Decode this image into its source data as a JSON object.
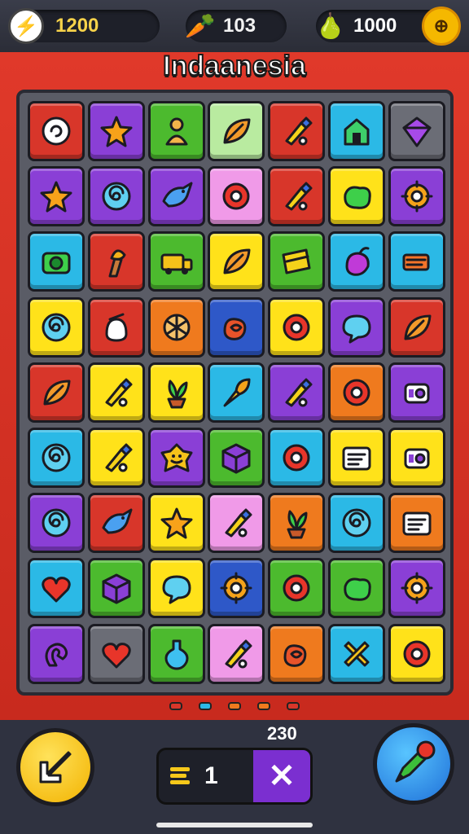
{
  "topbar": {
    "coins": "1200",
    "carrots": "103",
    "gems": "1000"
  },
  "title": "Indaanesia",
  "colors": {
    "red": "#d8362a",
    "purple": "#8a3fd6",
    "green": "#4cba2e",
    "lightgreen": "#b9eba0",
    "cyan": "#2bb9e6",
    "gray": "#6b6d76",
    "yellow": "#ffe21a",
    "pink": "#f09ae8",
    "orange": "#ef7a1e",
    "blue": "#2e58c8",
    "darkpurple": "#6a2fc0"
  },
  "board": {
    "rows": [
      [
        [
          "red",
          "swirl"
        ],
        [
          "purple",
          "star"
        ],
        [
          "green",
          "idol"
        ],
        [
          "lightgreen",
          "leaf"
        ],
        [
          "red",
          "crayon"
        ],
        [
          "cyan",
          "house"
        ],
        [
          "gray",
          "gem"
        ]
      ],
      [
        [
          "purple",
          "star"
        ],
        [
          "purple",
          "spiral"
        ],
        [
          "purple",
          "bird"
        ],
        [
          "pink",
          "ring"
        ],
        [
          "red",
          "crayon"
        ],
        [
          "yellow",
          "blob"
        ],
        [
          "purple",
          "gear"
        ]
      ],
      [
        [
          "cyan",
          "camera"
        ],
        [
          "red",
          "torch"
        ],
        [
          "green",
          "truck"
        ],
        [
          "yellow",
          "leaf"
        ],
        [
          "green",
          "book"
        ],
        [
          "cyan",
          "fruit"
        ],
        [
          "cyan",
          "cart"
        ]
      ],
      [
        [
          "yellow",
          "spiral"
        ],
        [
          "red",
          "sack"
        ],
        [
          "orange",
          "ball"
        ],
        [
          "blue",
          "knot"
        ],
        [
          "yellow",
          "ring"
        ],
        [
          "purple",
          "bubble"
        ],
        [
          "red",
          "leaf"
        ]
      ],
      [
        [
          "red",
          "leaf"
        ],
        [
          "yellow",
          "crayon"
        ],
        [
          "yellow",
          "plant"
        ],
        [
          "cyan",
          "brush"
        ],
        [
          "purple",
          "crayon"
        ],
        [
          "orange",
          "ring"
        ],
        [
          "purple",
          "tag"
        ]
      ],
      [
        [
          "cyan",
          "spiral"
        ],
        [
          "yellow",
          "crayon"
        ],
        [
          "purple",
          "smile"
        ],
        [
          "green",
          "box"
        ],
        [
          "cyan",
          "ring"
        ],
        [
          "yellow",
          "screen"
        ],
        [
          "yellow",
          "tag"
        ]
      ],
      [
        [
          "purple",
          "spiral"
        ],
        [
          "red",
          "bird"
        ],
        [
          "yellow",
          "star"
        ],
        [
          "pink",
          "crayon"
        ],
        [
          "orange",
          "plant"
        ],
        [
          "cyan",
          "spiral"
        ],
        [
          "orange",
          "screen"
        ]
      ],
      [
        [
          "cyan",
          "heart"
        ],
        [
          "green",
          "box"
        ],
        [
          "yellow",
          "bubble"
        ],
        [
          "blue",
          "gear"
        ],
        [
          "green",
          "ring"
        ],
        [
          "green",
          "blob"
        ],
        [
          "purple",
          "gear"
        ]
      ],
      [
        [
          "purple",
          "hook"
        ],
        [
          "gray",
          "heart"
        ],
        [
          "green",
          "potion"
        ],
        [
          "pink",
          "crayon"
        ],
        [
          "orange",
          "knot"
        ],
        [
          "cyan",
          "cross"
        ],
        [
          "yellow",
          "ring"
        ]
      ]
    ]
  },
  "dots": [
    "red",
    "cyan",
    "orange",
    "orange",
    "red"
  ],
  "bottom": {
    "score": "230",
    "counter_value": "1",
    "close_label": "✕"
  }
}
